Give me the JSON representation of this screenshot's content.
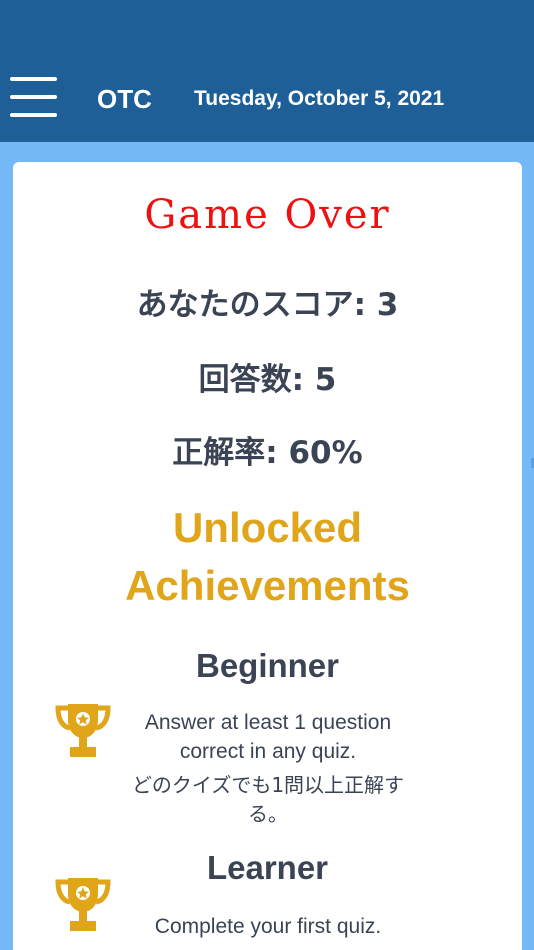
{
  "header": {
    "brand": "OTC",
    "date": "Tuesday, October 5, 2021",
    "menu_icon": "hamburger-menu-icon"
  },
  "colors": {
    "header_bg": "#1f5f98",
    "page_bg": "#74b8f6",
    "game_over": "#ee1111",
    "achievement_accent": "#e1a51a",
    "text": "#3b4454"
  },
  "result": {
    "title": "Game Over",
    "score_line": "あなたのスコア: 3",
    "answered_line": "回答数: 5",
    "accuracy_line": "正解率: 60%"
  },
  "achievements": {
    "heading_line1": "Unlocked",
    "heading_line2": "Achievements",
    "items": [
      {
        "name": "Beginner",
        "icon": "trophy-icon",
        "description": "Answer at least 1 question correct in any quiz.",
        "description_ja": "どのクイズでも1問以上正解する。"
      },
      {
        "name": "Learner",
        "icon": "trophy-icon",
        "description": "Complete your first quiz."
      }
    ]
  }
}
